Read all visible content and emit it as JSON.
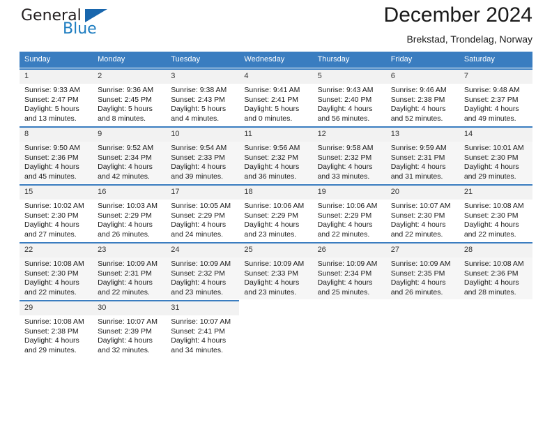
{
  "logo": {
    "word_top": "General",
    "word_bottom": "Blue",
    "brand_color": "#1c7cc0",
    "triangle_color": "#1866ad"
  },
  "header": {
    "title": "December 2024",
    "subtitle": "Brekstad, Trondelag, Norway"
  },
  "theme": {
    "header_bg": "#3a7dc0",
    "header_text": "#ffffff",
    "row_shade": "#f6f6f6",
    "daynum_shade": "#f2f2f2"
  },
  "calendar": {
    "weekday_headers": [
      "Sunday",
      "Monday",
      "Tuesday",
      "Wednesday",
      "Thursday",
      "Friday",
      "Saturday"
    ],
    "weeks": [
      [
        {
          "day": "1",
          "sunrise": "Sunrise: 9:33 AM",
          "sunset": "Sunset: 2:47 PM",
          "daylight1": "Daylight: 5 hours",
          "daylight2": "and 13 minutes."
        },
        {
          "day": "2",
          "sunrise": "Sunrise: 9:36 AM",
          "sunset": "Sunset: 2:45 PM",
          "daylight1": "Daylight: 5 hours",
          "daylight2": "and 8 minutes."
        },
        {
          "day": "3",
          "sunrise": "Sunrise: 9:38 AM",
          "sunset": "Sunset: 2:43 PM",
          "daylight1": "Daylight: 5 hours",
          "daylight2": "and 4 minutes."
        },
        {
          "day": "4",
          "sunrise": "Sunrise: 9:41 AM",
          "sunset": "Sunset: 2:41 PM",
          "daylight1": "Daylight: 5 hours",
          "daylight2": "and 0 minutes."
        },
        {
          "day": "5",
          "sunrise": "Sunrise: 9:43 AM",
          "sunset": "Sunset: 2:40 PM",
          "daylight1": "Daylight: 4 hours",
          "daylight2": "and 56 minutes."
        },
        {
          "day": "6",
          "sunrise": "Sunrise: 9:46 AM",
          "sunset": "Sunset: 2:38 PM",
          "daylight1": "Daylight: 4 hours",
          "daylight2": "and 52 minutes."
        },
        {
          "day": "7",
          "sunrise": "Sunrise: 9:48 AM",
          "sunset": "Sunset: 2:37 PM",
          "daylight1": "Daylight: 4 hours",
          "daylight2": "and 49 minutes."
        }
      ],
      [
        {
          "day": "8",
          "sunrise": "Sunrise: 9:50 AM",
          "sunset": "Sunset: 2:36 PM",
          "daylight1": "Daylight: 4 hours",
          "daylight2": "and 45 minutes."
        },
        {
          "day": "9",
          "sunrise": "Sunrise: 9:52 AM",
          "sunset": "Sunset: 2:34 PM",
          "daylight1": "Daylight: 4 hours",
          "daylight2": "and 42 minutes."
        },
        {
          "day": "10",
          "sunrise": "Sunrise: 9:54 AM",
          "sunset": "Sunset: 2:33 PM",
          "daylight1": "Daylight: 4 hours",
          "daylight2": "and 39 minutes."
        },
        {
          "day": "11",
          "sunrise": "Sunrise: 9:56 AM",
          "sunset": "Sunset: 2:32 PM",
          "daylight1": "Daylight: 4 hours",
          "daylight2": "and 36 minutes."
        },
        {
          "day": "12",
          "sunrise": "Sunrise: 9:58 AM",
          "sunset": "Sunset: 2:32 PM",
          "daylight1": "Daylight: 4 hours",
          "daylight2": "and 33 minutes."
        },
        {
          "day": "13",
          "sunrise": "Sunrise: 9:59 AM",
          "sunset": "Sunset: 2:31 PM",
          "daylight1": "Daylight: 4 hours",
          "daylight2": "and 31 minutes."
        },
        {
          "day": "14",
          "sunrise": "Sunrise: 10:01 AM",
          "sunset": "Sunset: 2:30 PM",
          "daylight1": "Daylight: 4 hours",
          "daylight2": "and 29 minutes."
        }
      ],
      [
        {
          "day": "15",
          "sunrise": "Sunrise: 10:02 AM",
          "sunset": "Sunset: 2:30 PM",
          "daylight1": "Daylight: 4 hours",
          "daylight2": "and 27 minutes."
        },
        {
          "day": "16",
          "sunrise": "Sunrise: 10:03 AM",
          "sunset": "Sunset: 2:29 PM",
          "daylight1": "Daylight: 4 hours",
          "daylight2": "and 26 minutes."
        },
        {
          "day": "17",
          "sunrise": "Sunrise: 10:05 AM",
          "sunset": "Sunset: 2:29 PM",
          "daylight1": "Daylight: 4 hours",
          "daylight2": "and 24 minutes."
        },
        {
          "day": "18",
          "sunrise": "Sunrise: 10:06 AM",
          "sunset": "Sunset: 2:29 PM",
          "daylight1": "Daylight: 4 hours",
          "daylight2": "and 23 minutes."
        },
        {
          "day": "19",
          "sunrise": "Sunrise: 10:06 AM",
          "sunset": "Sunset: 2:29 PM",
          "daylight1": "Daylight: 4 hours",
          "daylight2": "and 22 minutes."
        },
        {
          "day": "20",
          "sunrise": "Sunrise: 10:07 AM",
          "sunset": "Sunset: 2:30 PM",
          "daylight1": "Daylight: 4 hours",
          "daylight2": "and 22 minutes."
        },
        {
          "day": "21",
          "sunrise": "Sunrise: 10:08 AM",
          "sunset": "Sunset: 2:30 PM",
          "daylight1": "Daylight: 4 hours",
          "daylight2": "and 22 minutes."
        }
      ],
      [
        {
          "day": "22",
          "sunrise": "Sunrise: 10:08 AM",
          "sunset": "Sunset: 2:30 PM",
          "daylight1": "Daylight: 4 hours",
          "daylight2": "and 22 minutes."
        },
        {
          "day": "23",
          "sunrise": "Sunrise: 10:09 AM",
          "sunset": "Sunset: 2:31 PM",
          "daylight1": "Daylight: 4 hours",
          "daylight2": "and 22 minutes."
        },
        {
          "day": "24",
          "sunrise": "Sunrise: 10:09 AM",
          "sunset": "Sunset: 2:32 PM",
          "daylight1": "Daylight: 4 hours",
          "daylight2": "and 23 minutes."
        },
        {
          "day": "25",
          "sunrise": "Sunrise: 10:09 AM",
          "sunset": "Sunset: 2:33 PM",
          "daylight1": "Daylight: 4 hours",
          "daylight2": "and 23 minutes."
        },
        {
          "day": "26",
          "sunrise": "Sunrise: 10:09 AM",
          "sunset": "Sunset: 2:34 PM",
          "daylight1": "Daylight: 4 hours",
          "daylight2": "and 25 minutes."
        },
        {
          "day": "27",
          "sunrise": "Sunrise: 10:09 AM",
          "sunset": "Sunset: 2:35 PM",
          "daylight1": "Daylight: 4 hours",
          "daylight2": "and 26 minutes."
        },
        {
          "day": "28",
          "sunrise": "Sunrise: 10:08 AM",
          "sunset": "Sunset: 2:36 PM",
          "daylight1": "Daylight: 4 hours",
          "daylight2": "and 28 minutes."
        }
      ],
      [
        {
          "day": "29",
          "sunrise": "Sunrise: 10:08 AM",
          "sunset": "Sunset: 2:38 PM",
          "daylight1": "Daylight: 4 hours",
          "daylight2": "and 29 minutes."
        },
        {
          "day": "30",
          "sunrise": "Sunrise: 10:07 AM",
          "sunset": "Sunset: 2:39 PM",
          "daylight1": "Daylight: 4 hours",
          "daylight2": "and 32 minutes."
        },
        {
          "day": "31",
          "sunrise": "Sunrise: 10:07 AM",
          "sunset": "Sunset: 2:41 PM",
          "daylight1": "Daylight: 4 hours",
          "daylight2": "and 34 minutes."
        },
        {
          "day": "",
          "sunrise": "",
          "sunset": "",
          "daylight1": "",
          "daylight2": ""
        },
        {
          "day": "",
          "sunrise": "",
          "sunset": "",
          "daylight1": "",
          "daylight2": ""
        },
        {
          "day": "",
          "sunrise": "",
          "sunset": "",
          "daylight1": "",
          "daylight2": ""
        },
        {
          "day": "",
          "sunrise": "",
          "sunset": "",
          "daylight1": "",
          "daylight2": ""
        }
      ]
    ]
  }
}
